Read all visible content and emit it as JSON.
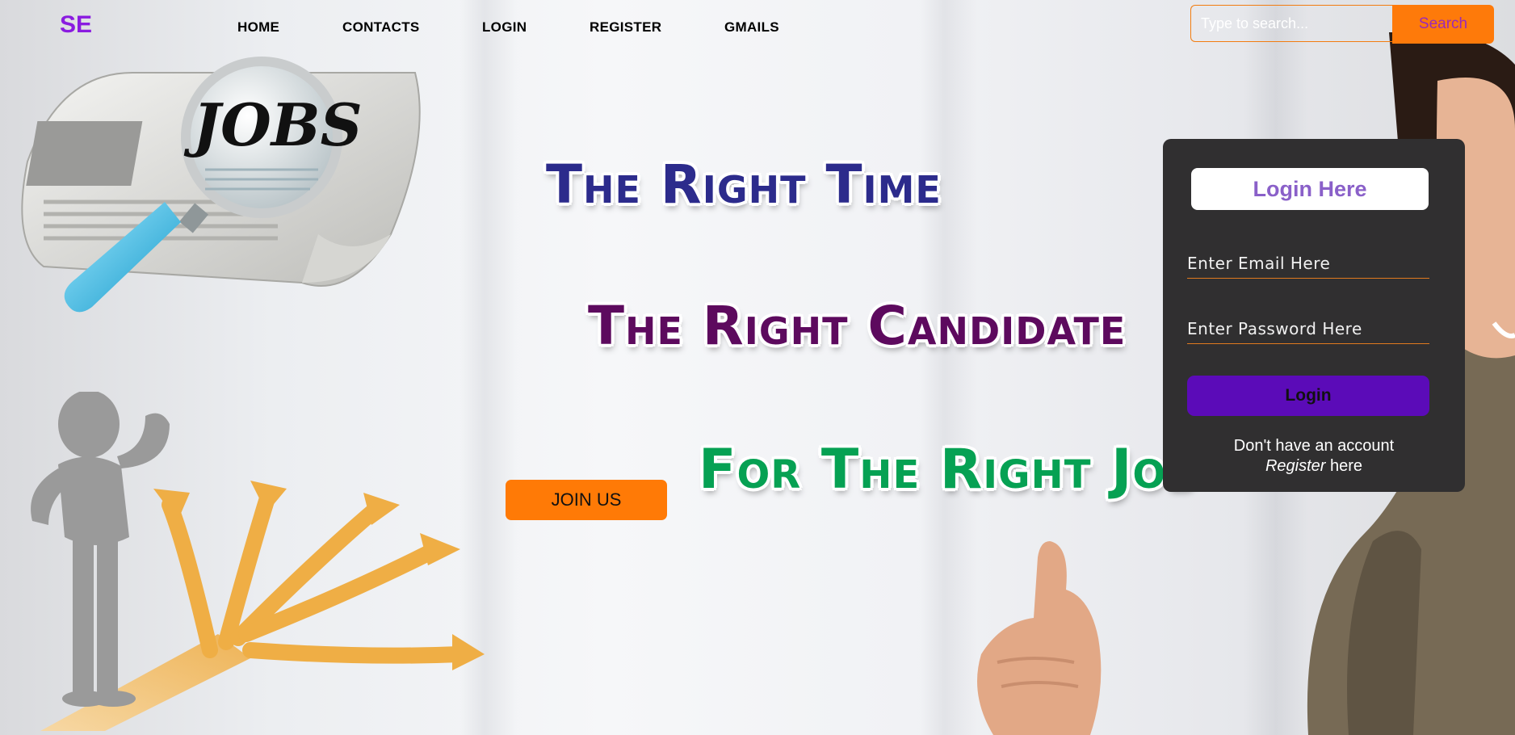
{
  "brand": "SE",
  "nav": [
    {
      "label": "HOME"
    },
    {
      "label": "CONTACTS"
    },
    {
      "label": "LOGIN"
    },
    {
      "label": "REGISTER"
    },
    {
      "label": "GMAILS"
    }
  ],
  "search": {
    "placeholder": "Type to search...",
    "button_label": "Search"
  },
  "hero": {
    "line1": "The Right Time",
    "line2": "The Right Candidate",
    "line3": "For The Right Job",
    "join_label": "JOIN US",
    "newspaper_text": "JOBS"
  },
  "login": {
    "title": "Login Here",
    "email_placeholder": "Enter Email Here",
    "password_placeholder": "Enter Password Here",
    "button_label": "Login",
    "register_prompt": "Don't have an account",
    "register_link": "Register",
    "register_suffix": " here"
  },
  "colors": {
    "brand": "#8a1be0",
    "accent": "#fe7a0a",
    "login_btn": "#5b0bb8",
    "panel": "#302f30"
  }
}
